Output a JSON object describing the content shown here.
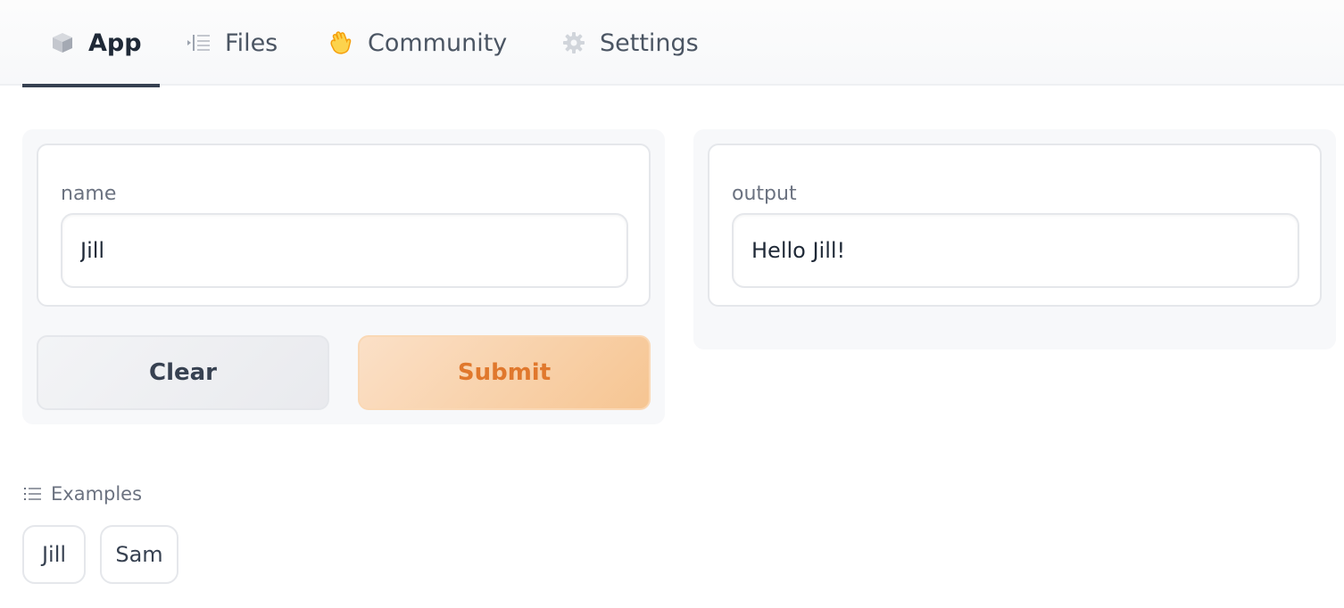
{
  "tabs": [
    {
      "label": "App",
      "icon": "cube-icon",
      "active": true
    },
    {
      "label": "Files",
      "icon": "file-list-icon",
      "active": false
    },
    {
      "label": "Community",
      "icon": "waving-hand-icon",
      "active": false
    },
    {
      "label": "Settings",
      "icon": "gear-icon",
      "active": false
    }
  ],
  "inputs": {
    "name": {
      "label": "name",
      "value": "Jill"
    }
  },
  "outputs": {
    "output": {
      "label": "output",
      "value": "Hello Jill!"
    }
  },
  "buttons": {
    "clear_label": "Clear",
    "submit_label": "Submit"
  },
  "examples": {
    "header": "Examples",
    "items": [
      "Jill",
      "Sam"
    ]
  },
  "colors": {
    "accent": "#e0782d",
    "submit_bg": "#f6c592",
    "active_tab_underline": "#374151"
  }
}
